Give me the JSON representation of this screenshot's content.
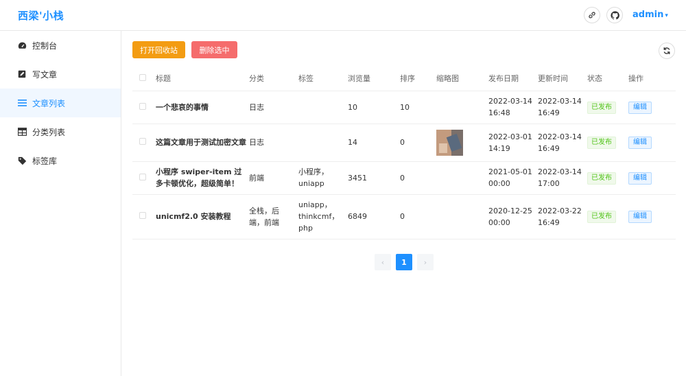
{
  "header": {
    "brand": "西梁'小栈",
    "user": "admin"
  },
  "sidebar": {
    "items": [
      {
        "label": "控制台",
        "icon": "dashboard-icon",
        "active": false
      },
      {
        "label": "写文章",
        "icon": "edit-icon",
        "active": false
      },
      {
        "label": "文章列表",
        "icon": "list-icon",
        "active": true
      },
      {
        "label": "分类列表",
        "icon": "table-icon",
        "active": false
      },
      {
        "label": "标签库",
        "icon": "tag-icon",
        "active": false
      }
    ]
  },
  "toolbar": {
    "recycle_label": "打开回收站",
    "delete_label": "删除选中"
  },
  "table": {
    "columns": [
      "标题",
      "分类",
      "标签",
      "浏览量",
      "排序",
      "缩略图",
      "发布日期",
      "更新时间",
      "状态",
      "操作"
    ],
    "rows": [
      {
        "title": "一个悲哀的事情",
        "category": "日志",
        "tags": "",
        "views": "10",
        "sort": "10",
        "thumb": false,
        "published": "2022-03-14 16:48",
        "updated": "2022-03-14 16:49",
        "status": "已发布",
        "action": "编辑"
      },
      {
        "title": "这篇文章用于测试加密文章",
        "category": "日志",
        "tags": "",
        "views": "14",
        "sort": "0",
        "thumb": true,
        "published": "2022-03-01 14:19",
        "updated": "2022-03-14 16:49",
        "status": "已发布",
        "action": "编辑"
      },
      {
        "title": "小程序 swiper-item 过多卡顿优化，超级简单！",
        "category": "前端",
        "tags": "小程序，uniapp",
        "views": "3451",
        "sort": "0",
        "thumb": false,
        "published": "2021-05-01 00:00",
        "updated": "2022-03-14 17:00",
        "status": "已发布",
        "action": "编辑"
      },
      {
        "title": "unicmf2.0 安装教程",
        "category": "全栈，后端，前端",
        "tags": "uniapp，thinkcmf，php",
        "views": "6849",
        "sort": "0",
        "thumb": false,
        "published": "2020-12-25 00:00",
        "updated": "2022-03-22 16:49",
        "status": "已发布",
        "action": "编辑"
      }
    ]
  },
  "pagination": {
    "current": "1",
    "prev": "‹",
    "next": "›"
  },
  "colors": {
    "accent": "#1e90ff",
    "orange": "#f39c12",
    "red": "#f56c6c",
    "success": "#52c41a"
  }
}
